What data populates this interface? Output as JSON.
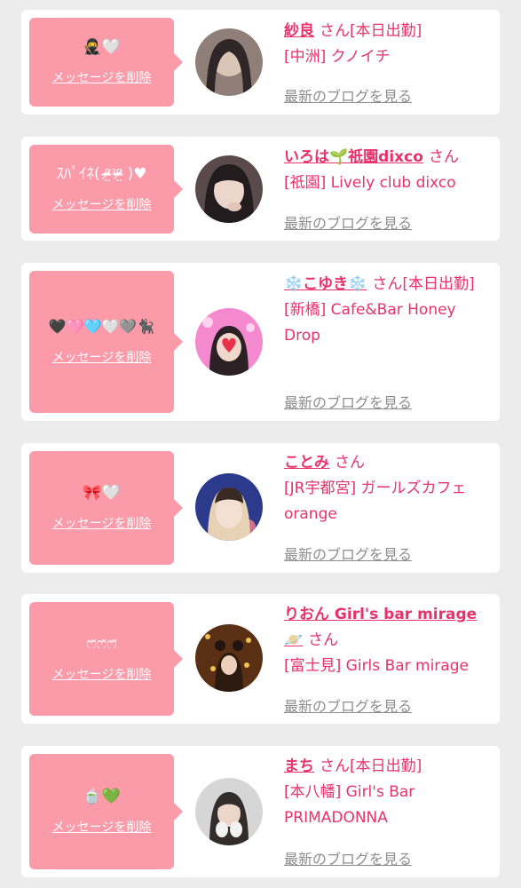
{
  "messages": [
    {
      "message": "🥷🤍",
      "delete_label": "メッセージを削除",
      "name": "紗良",
      "honorific": "さん",
      "status": "[本日出勤]",
      "shop": "[中洲] クノイチ",
      "blog_link": "最新のブログを見る",
      "avatar_colors": [
        "#3a3030",
        "#c9b7a8",
        "#1d1a1a"
      ]
    },
    {
      "message": "ｽﾊﾟｲﾈ( ᵒ̴̶̷̤ᵌᵒ̴̶̷̤ )♥",
      "delete_label": "メッセージを削除",
      "name": "いろは🌱祇園dixco",
      "honorific": "さん",
      "status": "",
      "shop": "[祇園] Lively club dixco",
      "blog_link": "最新のブログを見る",
      "avatar_colors": [
        "#2a2426",
        "#e6cfc6",
        "#4a3a3c"
      ]
    },
    {
      "message": "🖤🩷🩵🤍🩶🐈‍⬛",
      "delete_label": "メッセージを削除",
      "name": "❄️こゆき❄️",
      "honorific": "さん",
      "status": "[本日出勤]",
      "shop": "[新橋] Cafe&Bar Honey Drop",
      "blog_link": "最新のブログを見る",
      "avatar_colors": [
        "#f36ec4",
        "#ffb4e4",
        "#e8324a"
      ]
    },
    {
      "message": "🎀🤍",
      "delete_label": "メッセージを削除",
      "name": "ことみ",
      "honorific": "さん",
      "status": "",
      "shop": "[JR宇都宮] ガールズカフェ orange",
      "blog_link": "最新のブログを見る",
      "avatar_colors": [
        "#2b3a8a",
        "#e8d0b8",
        "#d07090"
      ]
    },
    {
      "message": "ෆ̈ෆ̈ෆ̈",
      "delete_label": "メッセージを削除",
      "name": "りおん Girl's bar mirage 🪐",
      "honorific": "さん",
      "status": "",
      "shop": "[富士見] Girls Bar mirage",
      "blog_link": "最新のブログを見る",
      "avatar_colors": [
        "#6b3a18",
        "#d8a040",
        "#2a1a10"
      ]
    },
    {
      "message": "🍵💚",
      "delete_label": "メッセージを削除",
      "name": "まち",
      "honorific": "さん",
      "status": "[本日出勤]",
      "shop": "[本八幡] Girl's Bar PRIMADONNA",
      "blog_link": "最新のブログを見る",
      "avatar_colors": [
        "#d8d8d8",
        "#3a3434",
        "#f2f2f2"
      ]
    }
  ],
  "colors": {
    "page_background": "#ececec",
    "bubble": "#fb9aa9",
    "accent": "#e8326b",
    "muted_link": "#8d8d8d"
  }
}
